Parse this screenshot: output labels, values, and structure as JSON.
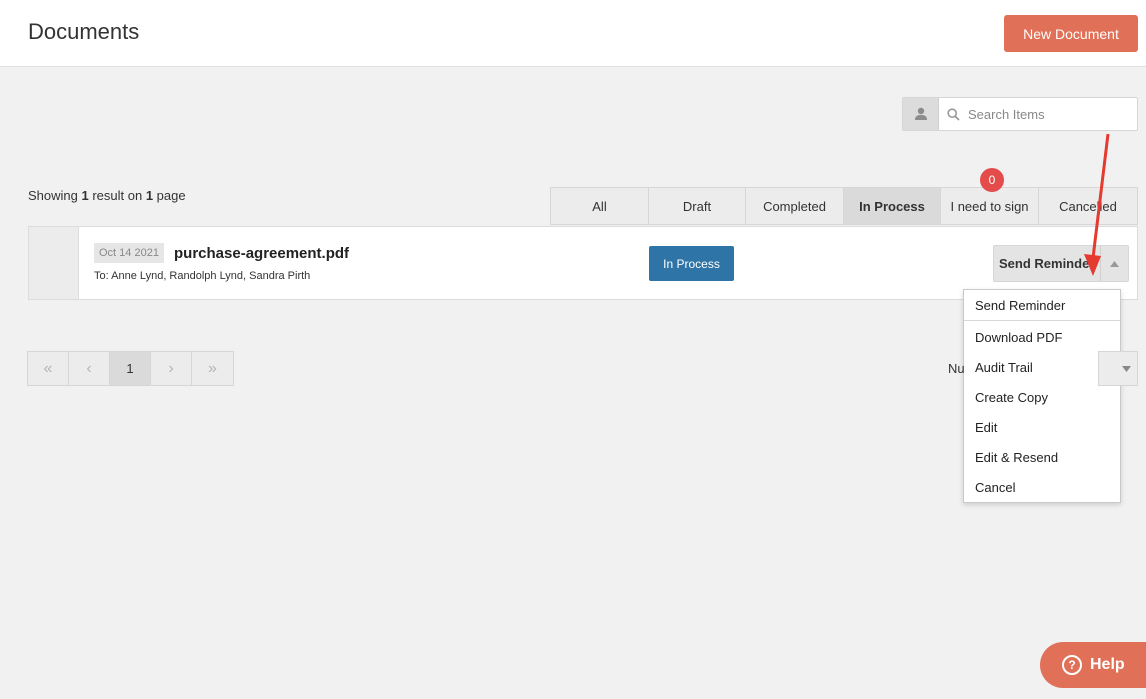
{
  "header": {
    "title": "Documents",
    "new_button": "New Document"
  },
  "search": {
    "placeholder": "Search Items"
  },
  "results": {
    "prefix": "Showing ",
    "count": "1",
    "middle": " result on ",
    "pages": "1",
    "suffix": " page"
  },
  "tabs": [
    {
      "label": "All"
    },
    {
      "label": "Draft"
    },
    {
      "label": "Completed"
    },
    {
      "label": "In Process"
    },
    {
      "label": "I need to sign",
      "badge": "0"
    },
    {
      "label": "Cancelled"
    }
  ],
  "document": {
    "date": "Oct 14 2021",
    "name": "purchase-agreement.pdf",
    "recipients": "To: Anne Lynd, Randolph Lynd, Sandra Pirth",
    "status": "In Process",
    "action": "Send Reminder"
  },
  "dropdown": {
    "items": [
      "Send Reminder",
      "Download PDF",
      "Audit Trail",
      "Create Copy",
      "Edit",
      "Edit & Resend",
      "Cancel"
    ]
  },
  "pagination": {
    "first": "«",
    "prev": "‹",
    "current": "1",
    "next": "›",
    "last": "»"
  },
  "per_page": {
    "label": "Nu"
  },
  "help": {
    "label": "Help",
    "icon_glyph": "?"
  },
  "colors": {
    "accent": "#e07057",
    "status_blue": "#2f74a7",
    "badge_red": "#e44b4b",
    "arrow_red": "#e53a2f"
  }
}
